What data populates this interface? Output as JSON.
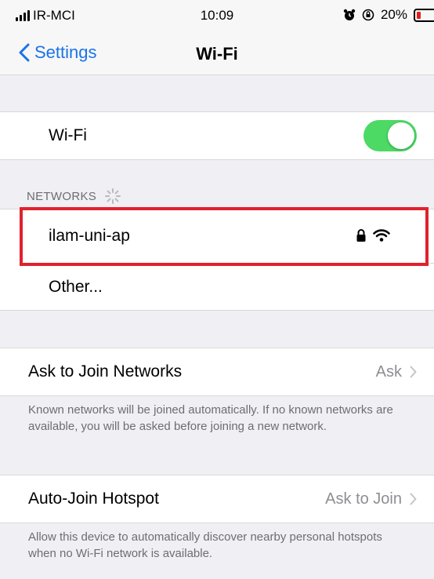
{
  "status_bar": {
    "carrier": "IR-MCI",
    "time": "10:09",
    "battery_percent": "20%",
    "battery_level": 0.2,
    "battery_color": "#e0201c"
  },
  "nav": {
    "back_label": "Settings",
    "title": "Wi-Fi"
  },
  "wifi": {
    "label": "Wi-Fi",
    "enabled": true,
    "toggle_color": "#4cd964"
  },
  "networks": {
    "header": "NETWORKS",
    "items": [
      {
        "name": "ilam-uni-ap",
        "secured": true,
        "signal": "full"
      }
    ],
    "other_label": "Other..."
  },
  "ask_to_join": {
    "label": "Ask to Join Networks",
    "value": "Ask",
    "footer": "Known networks will be joined automatically. If no known networks are available, you will be asked before joining a new network."
  },
  "auto_join_hotspot": {
    "label": "Auto-Join Hotspot",
    "value": "Ask to Join",
    "footer": "Allow this device to automatically discover nearby personal hotspots when no Wi-Fi network is available."
  },
  "highlight_color": "#e0222c",
  "accent": "#1a73e8"
}
